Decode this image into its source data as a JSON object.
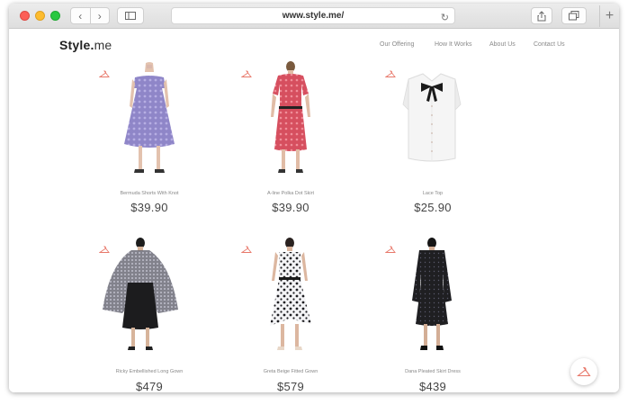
{
  "browser": {
    "url": "www.style.me/",
    "back_glyph": "‹",
    "forward_glyph": "›",
    "plus_glyph": "+",
    "reload_glyph": "↻"
  },
  "site": {
    "logo_bold": "Style.",
    "logo_light": "me",
    "nav": [
      "Our Offering",
      "How It Works",
      "About Us",
      "Contact Us"
    ]
  },
  "products": [
    {
      "name": "Bermuda Shorts With Knot",
      "price": "$39.90"
    },
    {
      "name": "A-line Polka Dot Skirt",
      "price": "$39.90"
    },
    {
      "name": "Lace Top",
      "price": "$25.90"
    },
    {
      "name": "Ricky Embellished Long Gown",
      "price": "$479"
    },
    {
      "name": "Greta Beige Fitted Gown",
      "price": "$579"
    },
    {
      "name": "Dana Pleated Skirt Dress",
      "price": "$439"
    }
  ],
  "colors": {
    "accent": "#e8786a",
    "dress_lavender": "#8f86c8",
    "dress_red": "#d64f5f",
    "dress_black": "#1f1f22"
  }
}
